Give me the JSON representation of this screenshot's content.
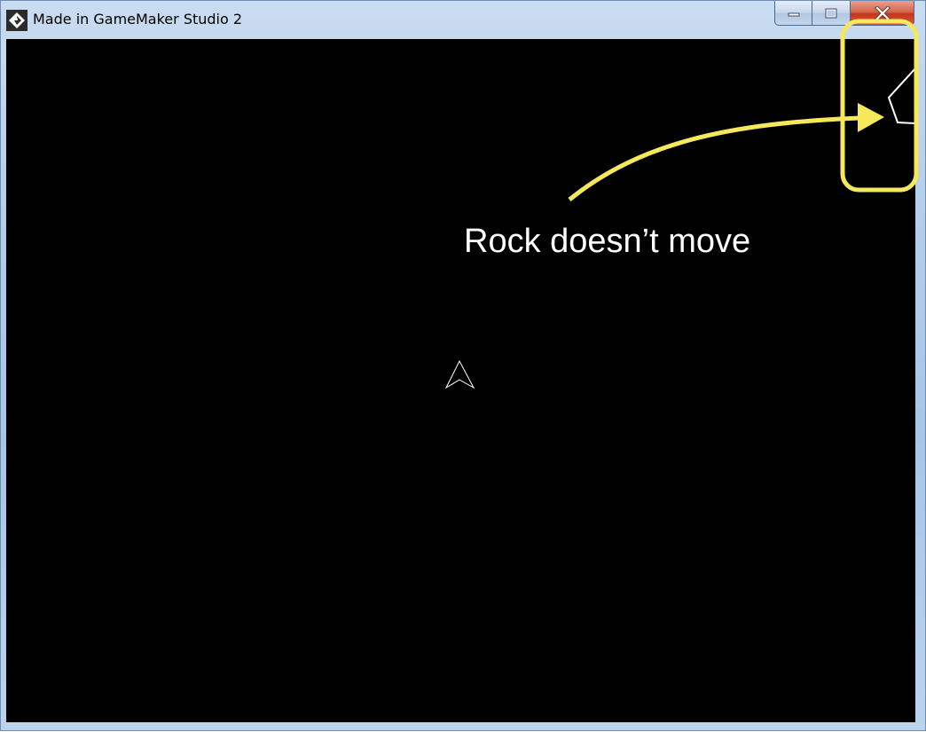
{
  "window": {
    "title": "Made in GameMaker Studio 2",
    "icon": "gamemaker-logo-icon",
    "buttons": {
      "minimize_icon": "minimize-icon",
      "maximize_icon": "maximize-icon",
      "close_icon": "close-icon"
    }
  },
  "game": {
    "background_color": "#000000",
    "player_ship": "arrowhead-ship",
    "rock": "polygon-rock-outline",
    "object_color": "#ffffff"
  },
  "annotation": {
    "text": "Rock doesn’t move",
    "highlight_color": "#f5e85a"
  }
}
